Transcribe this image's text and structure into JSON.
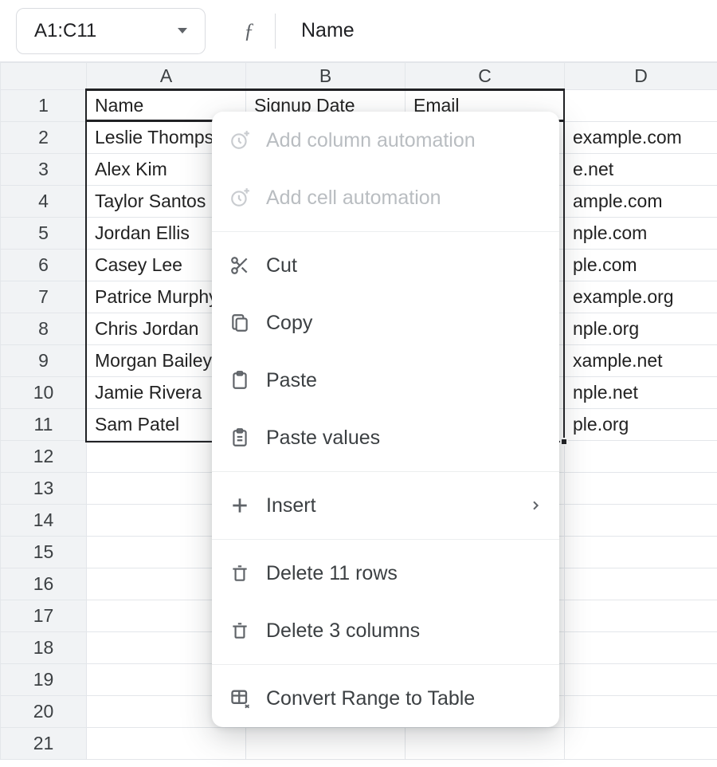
{
  "topbar": {
    "range": "A1:C11",
    "fx_symbol": "ƒ",
    "formula_value": "Name"
  },
  "columns": [
    "A",
    "B",
    "C",
    "D"
  ],
  "headers": {
    "A": "Name",
    "B": "Signup Date",
    "C": "Email"
  },
  "rows": [
    {
      "n": 1,
      "A": "Name",
      "B": "Signup Date",
      "C": "Email"
    },
    {
      "n": 2,
      "A": "Leslie Thompson",
      "C_tail": "example.com"
    },
    {
      "n": 3,
      "A": "Alex Kim",
      "C_tail": "e.net"
    },
    {
      "n": 4,
      "A": "Taylor Santos",
      "C_tail": "ample.com"
    },
    {
      "n": 5,
      "A": "Jordan Ellis",
      "C_tail": "nple.com"
    },
    {
      "n": 6,
      "A": "Casey Lee",
      "C_tail": "ple.com"
    },
    {
      "n": 7,
      "A": "Patrice Murphy",
      "C_tail": "example.org"
    },
    {
      "n": 8,
      "A": "Chris Jordan",
      "C_tail": "nple.org"
    },
    {
      "n": 9,
      "A": "Morgan Bailey",
      "C_tail": "xample.net"
    },
    {
      "n": 10,
      "A": "Jamie Rivera",
      "C_tail": "nple.net"
    },
    {
      "n": 11,
      "A": "Sam Patel",
      "C_tail": "ple.org"
    },
    {
      "n": 12
    },
    {
      "n": 13
    },
    {
      "n": 14
    },
    {
      "n": 15
    },
    {
      "n": 16
    },
    {
      "n": 17
    },
    {
      "n": 18
    },
    {
      "n": 19
    },
    {
      "n": 20
    },
    {
      "n": 21
    }
  ],
  "context_menu": {
    "add_column_automation": "Add column automation",
    "add_cell_automation": "Add cell automation",
    "cut": "Cut",
    "copy": "Copy",
    "paste": "Paste",
    "paste_values": "Paste values",
    "insert": "Insert",
    "delete_rows": "Delete 11 rows",
    "delete_columns": "Delete 3 columns",
    "convert_range": "Convert Range to Table"
  }
}
